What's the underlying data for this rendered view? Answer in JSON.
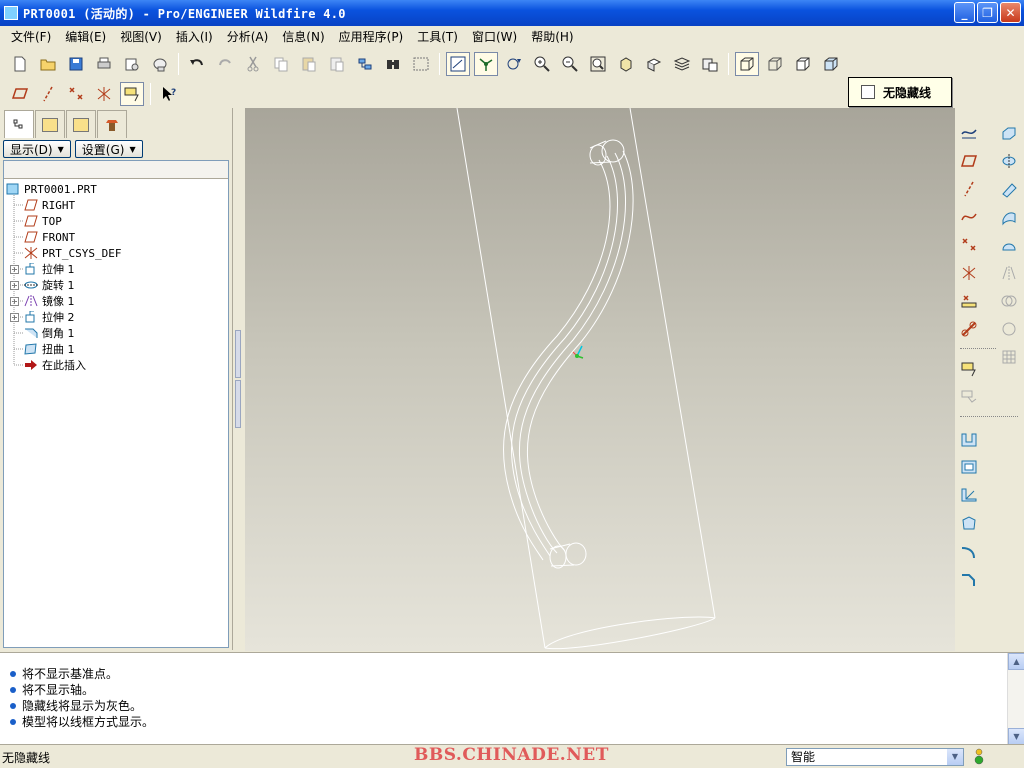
{
  "window": {
    "title": "PRT0001 (活动的) - Pro/ENGINEER Wildfire 4.0",
    "minimize": "_",
    "maximize": "❐",
    "close": "✕"
  },
  "menu": [
    "文件(F)",
    "编辑(E)",
    "视图(V)",
    "插入(I)",
    "分析(A)",
    "信息(N)",
    "应用程序(P)",
    "工具(T)",
    "窗口(W)",
    "帮助(H)"
  ],
  "tooltip": {
    "text": "无隐藏线"
  },
  "panel": {
    "display_btn": "显示(D)",
    "settings_btn": "设置(G)",
    "tree": [
      {
        "label": "PRT0001.PRT",
        "icon": "part-icon"
      },
      {
        "label": "RIGHT",
        "icon": "datum-plane-icon"
      },
      {
        "label": "TOP",
        "icon": "datum-plane-icon"
      },
      {
        "label": "FRONT",
        "icon": "datum-plane-icon"
      },
      {
        "label": "PRT_CSYS_DEF",
        "icon": "csys-icon"
      },
      {
        "label": "拉伸 1",
        "icon": "extrude-icon",
        "expandable": true
      },
      {
        "label": "旋转 1",
        "icon": "revolve-icon",
        "expandable": true
      },
      {
        "label": "镜像 1",
        "icon": "mirror-icon",
        "expandable": true
      },
      {
        "label": "拉伸 2",
        "icon": "extrude-icon",
        "expandable": true
      },
      {
        "label": "倒角 1",
        "icon": "chamfer-icon"
      },
      {
        "label": "扭曲 1",
        "icon": "warp-icon"
      },
      {
        "label": "在此插入",
        "icon": "insert-here-arrow-icon"
      }
    ]
  },
  "messages": [
    "将不显示基准点。",
    "将不显示轴。",
    "隐藏线将显示为灰色。",
    "模型将以线框方式显示。"
  ],
  "status": {
    "text": "无隐藏线",
    "watermark": "BBS.CHINADE.NET",
    "filter": "智能"
  },
  "colors": {
    "titlebar": "#0a52de",
    "viewport_top": "#a8a59a",
    "viewport_bottom": "#e6e4da",
    "wireframe": "#ffffff",
    "watermark": "#e05a5a"
  }
}
